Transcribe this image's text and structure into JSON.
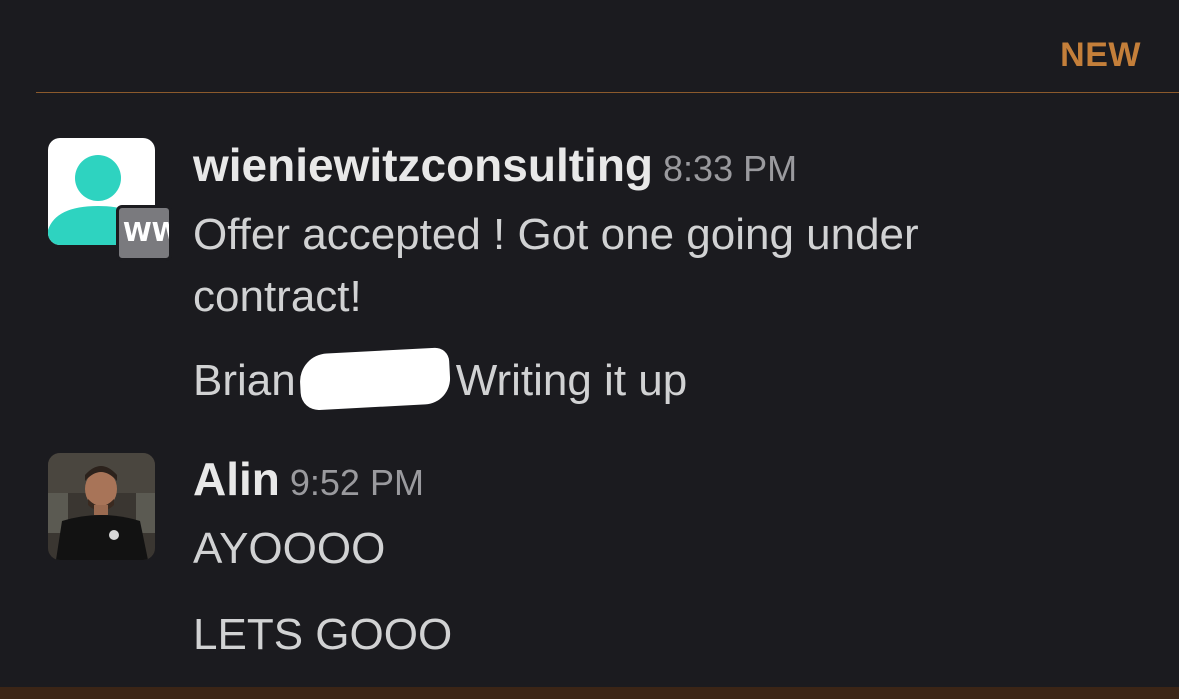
{
  "divider": {
    "label": "NEW"
  },
  "colors": {
    "background": "#1b1b1f",
    "new_accent": "#c47f3a",
    "avatar_teal": "#2ed3c0",
    "badge_gray": "#7a7a7e"
  },
  "messages": [
    {
      "author": "wieniewitzconsulting",
      "time": "8:33 PM",
      "avatar_icon": "user-silhouette-icon",
      "badge": "WW",
      "lines": [
        "Offer accepted !   Got one going under",
        "contract!"
      ],
      "line2_before": "Brian",
      "line2_after": "Writing it up"
    },
    {
      "author": "Alin",
      "time": "9:52 PM",
      "avatar_icon": "profile-photo",
      "lines": [
        "AYOOOO",
        "LETS GOOO"
      ]
    }
  ]
}
